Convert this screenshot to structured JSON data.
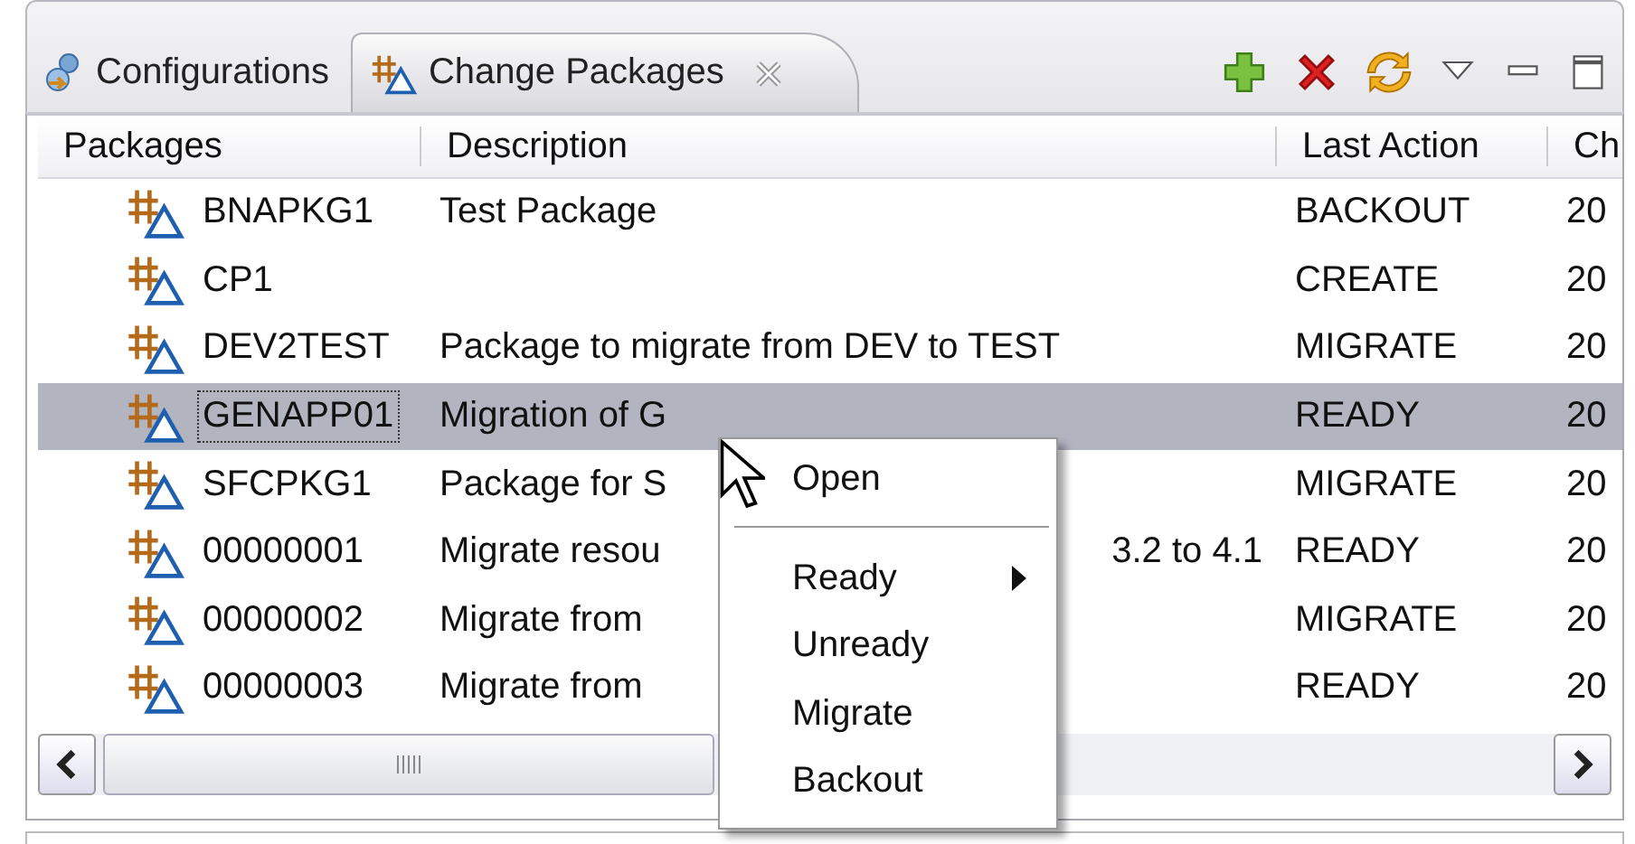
{
  "tabs": [
    {
      "label": "Configurations",
      "selected": false
    },
    {
      "label": "Change Packages",
      "selected": true
    }
  ],
  "table": {
    "columns": [
      "Packages",
      "Description",
      "Last Action",
      "Ch"
    ],
    "rows": [
      {
        "name": "BNAPKG1",
        "description": "Test Package",
        "description_tail": "",
        "last_action": "BACKOUT",
        "column_4": "20",
        "selected": false
      },
      {
        "name": "CP1",
        "description": "",
        "description_tail": "",
        "last_action": "CREATE",
        "column_4": "20",
        "selected": false
      },
      {
        "name": "DEV2TEST",
        "description": "Package to migrate from DEV to TEST",
        "description_tail": "",
        "last_action": "MIGRATE",
        "column_4": "20",
        "selected": false
      },
      {
        "name": "GENAPP01",
        "description": "Migration of G",
        "description_tail": "",
        "last_action": "READY",
        "column_4": "20",
        "selected": true
      },
      {
        "name": "SFCPKG1",
        "description": "Package for S",
        "description_tail": "",
        "last_action": "MIGRATE",
        "column_4": "20",
        "selected": false
      },
      {
        "name": "00000001",
        "description": "Migrate resou",
        "description_tail": "3.2 to 4.1",
        "last_action": "READY",
        "column_4": "20",
        "selected": false
      },
      {
        "name": "00000002",
        "description": "Migrate from",
        "description_tail": "",
        "last_action": "MIGRATE",
        "column_4": "20",
        "selected": false
      },
      {
        "name": "00000003",
        "description": "Migrate from",
        "description_tail": "",
        "last_action": "READY",
        "column_4": "20",
        "selected": false
      }
    ]
  },
  "context_menu": [
    {
      "kind": "item",
      "label": "Open",
      "submenu": false
    },
    {
      "kind": "separator"
    },
    {
      "kind": "item",
      "label": "Ready",
      "submenu": true
    },
    {
      "kind": "item",
      "label": "Unready",
      "submenu": false
    },
    {
      "kind": "item",
      "label": "Migrate",
      "submenu": false
    },
    {
      "kind": "item",
      "label": "Backout",
      "submenu": false
    }
  ]
}
